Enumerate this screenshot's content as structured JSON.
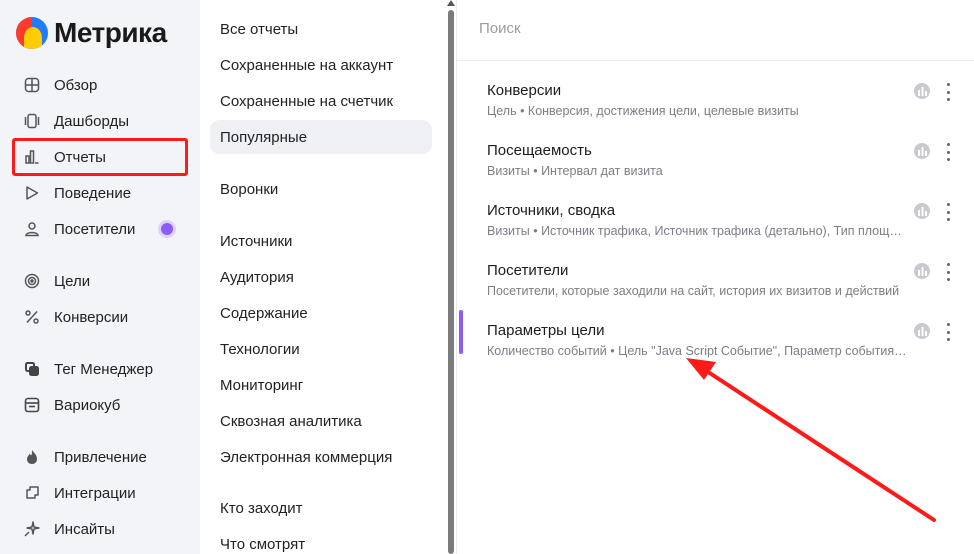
{
  "app": {
    "name": "Метрика"
  },
  "sidebar": {
    "items": [
      {
        "label": "Обзор",
        "icon": "grid-icon"
      },
      {
        "label": "Дашборды",
        "icon": "dashboards-icon"
      },
      {
        "label": "Отчеты",
        "icon": "bar-chart-icon",
        "active": true
      },
      {
        "label": "Поведение",
        "icon": "play-icon"
      },
      {
        "label": "Посетители",
        "icon": "user-icon",
        "badge": true
      },
      {
        "label": "Цели",
        "icon": "target-icon"
      },
      {
        "label": "Конверсии",
        "icon": "percent-icon"
      },
      {
        "label": "Тег Менеджер",
        "icon": "tag-manager-icon"
      },
      {
        "label": "Вариокуб",
        "icon": "variocube-icon"
      },
      {
        "label": "Привлечение",
        "icon": "flame-icon"
      },
      {
        "label": "Интеграции",
        "icon": "integrations-icon"
      },
      {
        "label": "Инсайты",
        "icon": "sparkle-icon"
      }
    ]
  },
  "menu": {
    "items": [
      {
        "label": "Все отчеты"
      },
      {
        "label": "Сохраненные на аккаунт"
      },
      {
        "label": "Сохраненные на счетчик"
      },
      {
        "label": "Популярные",
        "selected": true
      },
      {
        "label": "Воронки"
      },
      {
        "label": "Источники"
      },
      {
        "label": "Аудитория"
      },
      {
        "label": "Содержание"
      },
      {
        "label": "Технологии"
      },
      {
        "label": "Мониторинг"
      },
      {
        "label": "Сквозная аналитика"
      },
      {
        "label": "Электронная коммерция"
      },
      {
        "label": "Кто заходит"
      },
      {
        "label": "Что смотрят"
      }
    ]
  },
  "content": {
    "search_placeholder": "Поиск",
    "reports": [
      {
        "title": "Конверсии",
        "desc": "Цель • Конверсия, достижения цели, целевые визиты"
      },
      {
        "title": "Посещаемость",
        "desc": "Визиты • Интервал дат визита"
      },
      {
        "title": "Источники, сводка",
        "desc": "Визиты • Источник трафика, Источник трафика (детально), Тип площадки"
      },
      {
        "title": "Посетители",
        "desc": "Посетители, которые заходили на сайт, история их визитов и действий"
      },
      {
        "title": "Параметры цели",
        "desc": "Количество событий • Цель \"Java Script Событие\", Параметр события, ур. ...",
        "active": true
      }
    ]
  },
  "colors": {
    "accent": "#8b5cf6",
    "highlight": "#ff1a1a",
    "sidebar_bg": "#f3f4f7"
  }
}
